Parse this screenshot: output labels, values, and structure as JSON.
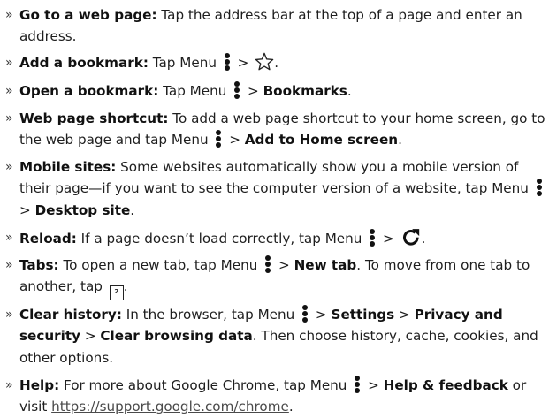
{
  "chevron": "»",
  "items": [
    {
      "title": "Go to a web page:",
      "text": " Tap the address bar at the top of a page and enter an address."
    },
    {
      "title": "Add a bookmark:",
      "text1": " Tap Menu ",
      "text2": " > ",
      "text3": "."
    },
    {
      "title": "Open a bookmark:",
      "text1": " Tap Menu ",
      "text2": " > ",
      "bold": "Bookmarks",
      "text3": "."
    },
    {
      "title": "Web page shortcut:",
      "text1": " To add a web page shortcut to your home screen, go to the web page and tap Menu ",
      "text2": " > ",
      "bold": "Add to Home screen",
      "text3": "."
    },
    {
      "title": "Mobile sites:",
      "text1": " Some websites automatically show you a mobile version of their page—if you want to see the computer version of a website, tap Menu ",
      "text2": " > ",
      "bold": "Desktop site",
      "text3": "."
    },
    {
      "title": "Reload:",
      "text1": " If a page doesn’t load correctly, tap Menu ",
      "text2": " > ",
      "text3": "."
    },
    {
      "title": "Tabs:",
      "text1": " To open a new tab, tap Menu ",
      "text2": " > ",
      "bold": "New tab",
      "text3": ". To move from one tab to another, tap ",
      "tab_count": "2",
      "text4": "."
    },
    {
      "title": "Clear history:",
      "text1": " In the browser, tap Menu ",
      "text2": " > ",
      "bold1": "Settings",
      "text3": " > ",
      "bold2": "Privacy and security",
      "text4": " > ",
      "bold3": "Clear browsing data",
      "text5": ". Then choose history, cache, cookies, and other options."
    },
    {
      "title": "Help:",
      "text1": " For more about Google Chrome, tap Menu ",
      "text2": " > ",
      "bold": "Help & feedback",
      "text3": " or visit ",
      "link": "https://support.google.com/chrome",
      "text4": "."
    }
  ]
}
